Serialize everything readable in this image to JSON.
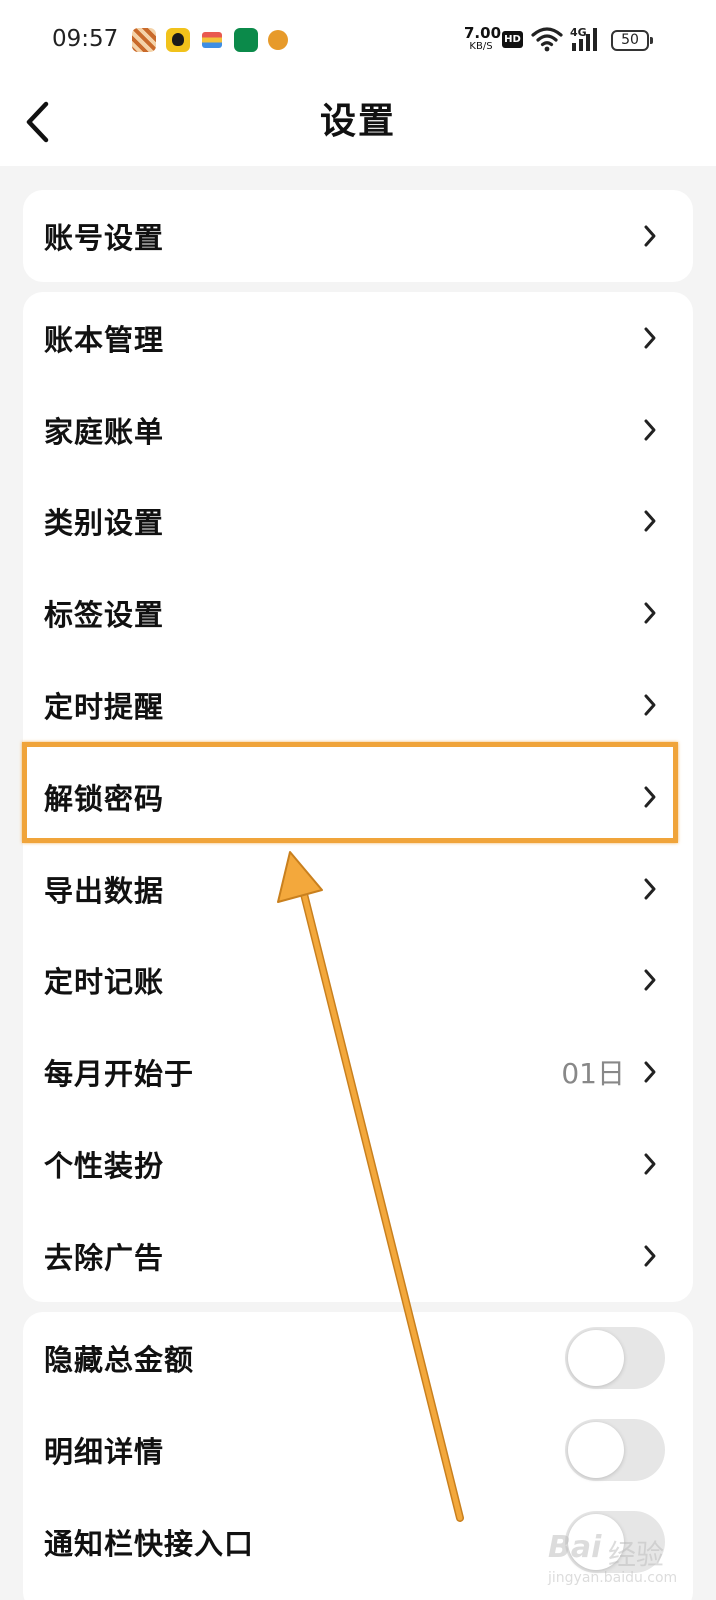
{
  "status_bar": {
    "time": "09:57",
    "net_speed_value": "7.00",
    "net_speed_unit": "KB/S",
    "hd_badge": "HD",
    "network_type": "4G",
    "battery": "50",
    "app_icons": [
      "game-icon",
      "qq-icon",
      "wallet-icon",
      "oppo-icon",
      "coin-icon"
    ]
  },
  "header": {
    "back_icon": "chevron-left-icon",
    "title": "设置"
  },
  "groups": [
    {
      "items": [
        {
          "label": "账号设置",
          "control": "chevron"
        }
      ]
    },
    {
      "items": [
        {
          "label": "账本管理",
          "control": "chevron"
        },
        {
          "label": "家庭账单",
          "control": "chevron"
        },
        {
          "label": "类别设置",
          "control": "chevron"
        },
        {
          "label": "标签设置",
          "control": "chevron"
        },
        {
          "label": "定时提醒",
          "control": "chevron"
        },
        {
          "label": "解锁密码",
          "control": "chevron",
          "highlighted": true
        },
        {
          "label": "导出数据",
          "control": "chevron"
        },
        {
          "label": "定时记账",
          "control": "chevron"
        },
        {
          "label": "每月开始于",
          "control": "chevron",
          "value": "01日"
        },
        {
          "label": "个性装扮",
          "control": "chevron"
        },
        {
          "label": "去除广告",
          "control": "chevron"
        }
      ]
    },
    {
      "items": [
        {
          "label": "隐藏总金额",
          "control": "toggle",
          "on": false
        },
        {
          "label": "明细详情",
          "control": "toggle",
          "on": false
        },
        {
          "label": "通知栏快接入口",
          "control": "toggle",
          "on": false
        }
      ]
    }
  ],
  "annotation": {
    "highlight_color": "#f0a43a",
    "arrow_color": "#f0a43a"
  },
  "watermark": {
    "brand": "Bai",
    "brand_suffix": "经验",
    "url": "jingyan.baidu.com"
  },
  "colors": {
    "background": "#f4f4f4",
    "card": "#ffffff",
    "text": "#111111",
    "secondary_text": "#888888",
    "toggle_off": "#e6e6e6"
  }
}
